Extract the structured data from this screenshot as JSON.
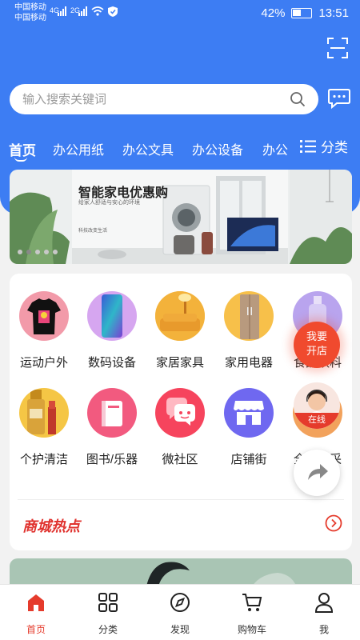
{
  "status_bar": {
    "carrier1": "中国移动",
    "carrier2": "中国移动",
    "net1": "4G",
    "net2": "2G",
    "battery": "42%",
    "time": "13:51"
  },
  "search": {
    "placeholder": "输入搜索关键词"
  },
  "tabs": [
    {
      "label": "首页",
      "active": true
    },
    {
      "label": "办公用纸"
    },
    {
      "label": "办公文具"
    },
    {
      "label": "办公设备"
    },
    {
      "label": "办公"
    }
  ],
  "category_button": "分类",
  "banner": {
    "title": "智能家电优惠购",
    "subtitle": "给家人舒适与安心的环境",
    "note": "科技改变生活",
    "dot_count": 5,
    "active_dot": 1
  },
  "categories": [
    {
      "label": "运动户外",
      "icon": "tshirt-icon"
    },
    {
      "label": "数码设备",
      "icon": "smartphone-icon"
    },
    {
      "label": "家居家具",
      "icon": "sofa-icon"
    },
    {
      "label": "家用电器",
      "icon": "refrigerator-icon"
    },
    {
      "label": "食品饮料",
      "icon": "bottle-icon"
    },
    {
      "label": "个护清洁",
      "icon": "cosmetics-icon"
    },
    {
      "label": "图书/乐器",
      "icon": "book-icon"
    },
    {
      "label": "微社区",
      "icon": "chat-bubbles-icon"
    },
    {
      "label": "店铺街",
      "icon": "storefront-icon"
    },
    {
      "label": "全球直采",
      "icon": "globe-icon"
    }
  ],
  "hot_section": {
    "logo_text": "商城热点"
  },
  "floating": {
    "open_store_line1": "我要",
    "open_store_line2": "开店",
    "customer_service": "在线"
  },
  "tabbar": [
    {
      "label": "首页",
      "icon": "home-icon",
      "active": true
    },
    {
      "label": "分类",
      "icon": "grid-icon"
    },
    {
      "label": "发现",
      "icon": "compass-icon"
    },
    {
      "label": "购物车",
      "icon": "cart-icon"
    },
    {
      "label": "我",
      "icon": "user-icon"
    }
  ],
  "colors": {
    "primary_blue": "#3d7df3",
    "accent_red": "#e53b2c"
  }
}
